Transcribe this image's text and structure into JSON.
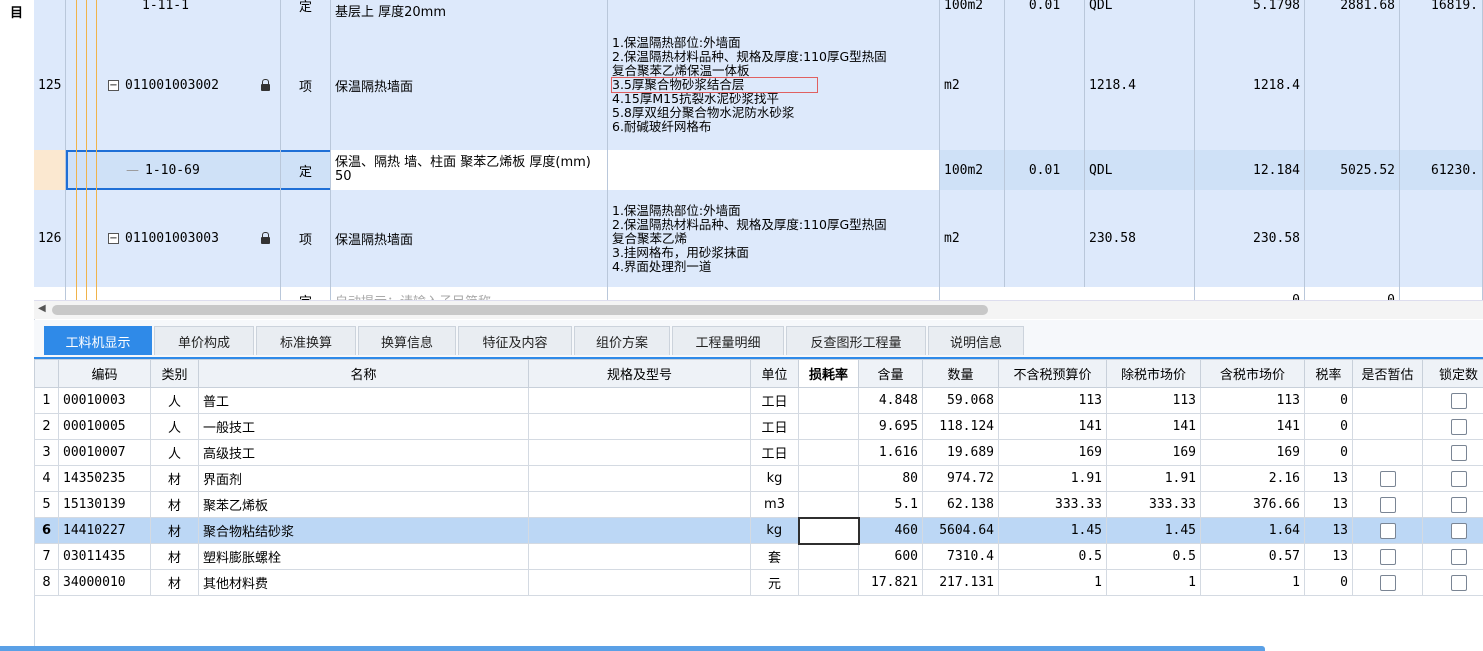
{
  "left_label": "目",
  "upper_grid": {
    "top_row": {
      "code": "1-11-1",
      "type": "定",
      "name": "基层上 厚度20mm",
      "unit": "100m2",
      "qty1": "0.01",
      "basis": "QDL",
      "amount": "5.1798",
      "price": "2881.68",
      "total": "16819."
    },
    "rows": [
      {
        "no": "125",
        "code": "011001003002",
        "type": "项",
        "name": "保温隔热墙面",
        "features": [
          "1.保温隔热部位:外墙面",
          "2.保温隔热材料品种、规格及厚度:110厚G型热固",
          "复合聚苯乙烯保温一体板",
          "3.5厚聚合物砂浆结合层",
          "4.15厚M15抗裂水泥砂浆找平",
          "5.8厚双组分聚合物水泥防水砂浆",
          "6.耐碱玻纤网格布"
        ],
        "unit": "m2",
        "qty_expr": "1218.4",
        "qty": "1218.4"
      },
      {
        "no": "",
        "code": "1-10-69",
        "type": "定",
        "name": "保温、隔热 墙、柱面 聚苯乙烯板 厚度(mm) 50",
        "unit": "100m2",
        "qty1": "0.01",
        "basis": "QDL",
        "amount": "12.184",
        "price": "5025.52",
        "total": "61230."
      },
      {
        "no": "126",
        "code": "011001003003",
        "type": "项",
        "name": "保温隔热墙面",
        "features": [
          "1.保温隔热部位:外墙面",
          "2.保温隔热材料品种、规格及厚度:110厚G型热固",
          "复合聚苯乙烯",
          "3.挂网格布，用砂浆抹面",
          "4.界面处理剂一道"
        ],
        "unit": "m2",
        "qty_expr": "230.58",
        "qty": "230.58"
      },
      {
        "type": "定",
        "name": "自动提示：请输入子目简称",
        "amount": "0",
        "price": "0"
      }
    ]
  },
  "tabs": [
    {
      "label": "工料机显示",
      "active": true
    },
    {
      "label": "单价构成"
    },
    {
      "label": "标准换算"
    },
    {
      "label": "换算信息"
    },
    {
      "label": "特征及内容"
    },
    {
      "label": "组价方案"
    },
    {
      "label": "工程量明细"
    },
    {
      "label": "反查图形工程量"
    },
    {
      "label": "说明信息"
    }
  ],
  "lower_table": {
    "headers": [
      "",
      "编码",
      "类别",
      "名称",
      "规格及型号",
      "单位",
      "损耗率",
      "含量",
      "数量",
      "不含税预算价",
      "除税市场价",
      "含税市场价",
      "税率",
      "是否暂估",
      "锁定数"
    ],
    "rows": [
      {
        "idx": "1",
        "code": "00010003",
        "cat": "人",
        "name": "普工",
        "spec": "",
        "unit": "工日",
        "loss": "",
        "content": "4.848",
        "qty": "59.068",
        "pre_tax": "113",
        "market": "113",
        "tax_market": "113",
        "tax_rate": "0",
        "estimate": false,
        "lock": true
      },
      {
        "idx": "2",
        "code": "00010005",
        "cat": "人",
        "name": "一般技工",
        "spec": "",
        "unit": "工日",
        "loss": "",
        "content": "9.695",
        "qty": "118.124",
        "pre_tax": "141",
        "market": "141",
        "tax_market": "141",
        "tax_rate": "0",
        "estimate": false,
        "lock": true
      },
      {
        "idx": "3",
        "code": "00010007",
        "cat": "人",
        "name": "高级技工",
        "spec": "",
        "unit": "工日",
        "loss": "",
        "content": "1.616",
        "qty": "19.689",
        "pre_tax": "169",
        "market": "169",
        "tax_market": "169",
        "tax_rate": "0",
        "estimate": false,
        "lock": true
      },
      {
        "idx": "4",
        "code": "14350235",
        "cat": "材",
        "name": "界面剂",
        "spec": "",
        "unit": "kg",
        "loss": "",
        "content": "80",
        "qty": "974.72",
        "pre_tax": "1.91",
        "market": "1.91",
        "tax_market": "2.16",
        "tax_rate": "13",
        "estimate": true,
        "lock": true
      },
      {
        "idx": "5",
        "code": "15130139",
        "cat": "材",
        "name": "聚苯乙烯板",
        "spec": "",
        "unit": "m3",
        "loss": "",
        "content": "5.1",
        "qty": "62.138",
        "pre_tax": "333.33",
        "market": "333.33",
        "tax_market": "376.66",
        "tax_rate": "13",
        "estimate": true,
        "lock": true
      },
      {
        "idx": "6",
        "code": "14410227",
        "cat": "材",
        "name": "聚合物粘结砂浆",
        "spec": "",
        "unit": "kg",
        "loss": "",
        "content": "460",
        "qty": "5604.64",
        "pre_tax": "1.45",
        "market": "1.45",
        "tax_market": "1.64",
        "tax_rate": "13",
        "estimate": true,
        "lock": true,
        "selected": true
      },
      {
        "idx": "7",
        "code": "03011435",
        "cat": "材",
        "name": "塑料膨胀螺栓",
        "spec": "",
        "unit": "套",
        "loss": "",
        "content": "600",
        "qty": "7310.4",
        "pre_tax": "0.5",
        "market": "0.5",
        "tax_market": "0.57",
        "tax_rate": "13",
        "estimate": true,
        "lock": true
      },
      {
        "idx": "8",
        "code": "34000010",
        "cat": "材",
        "name": "其他材料费",
        "spec": "",
        "unit": "元",
        "loss": "",
        "content": "17.821",
        "qty": "217.131",
        "pre_tax": "1",
        "market": "1",
        "tax_market": "1",
        "tax_rate": "0",
        "estimate": true,
        "lock": true
      }
    ]
  }
}
